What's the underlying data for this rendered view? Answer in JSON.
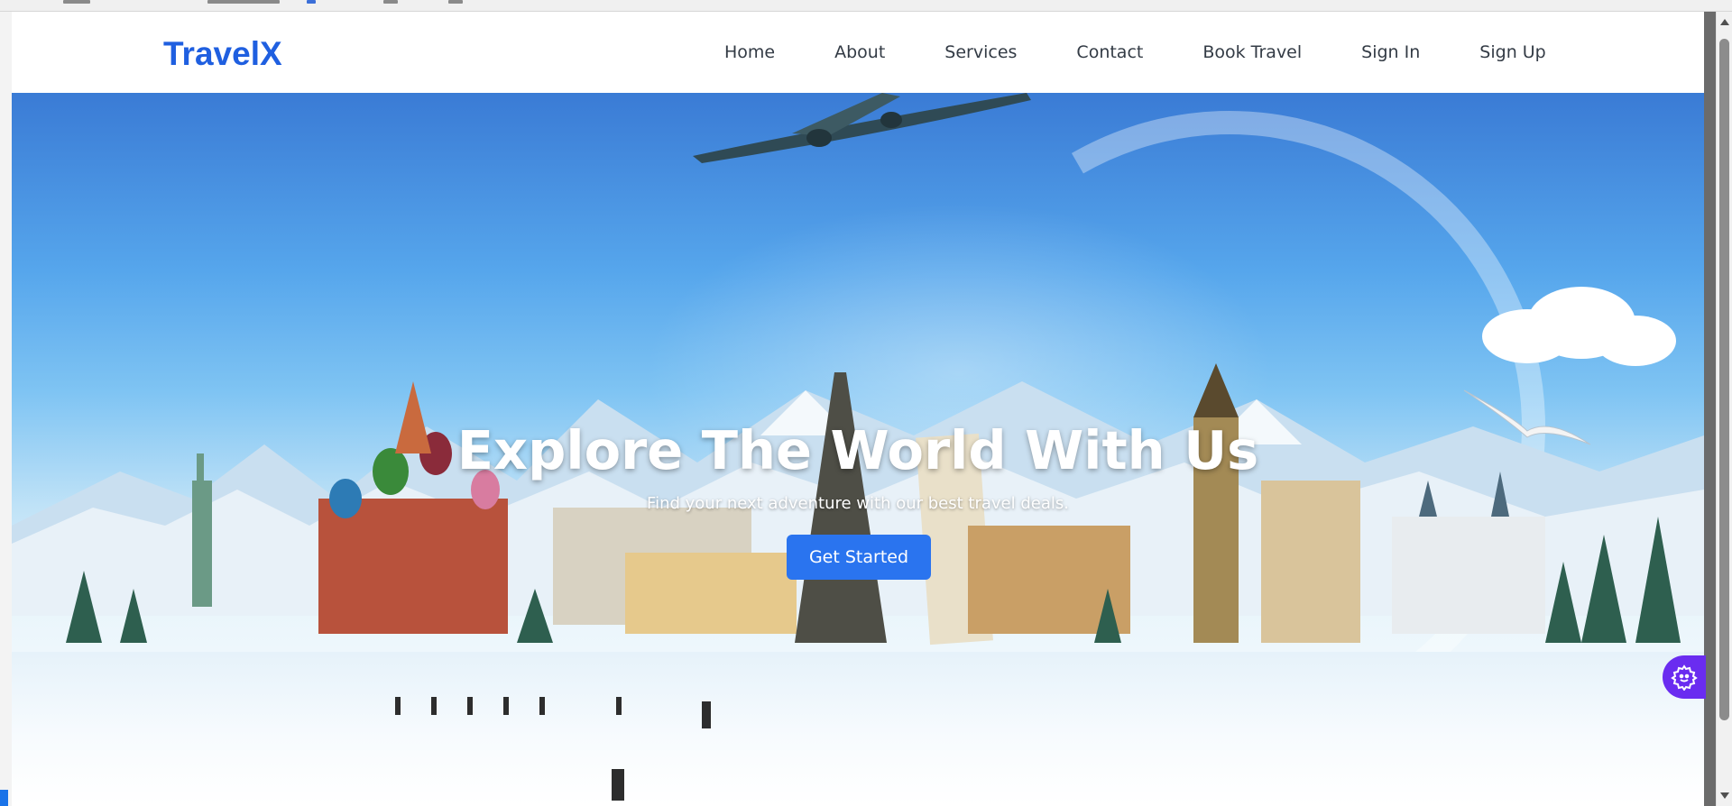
{
  "brand": {
    "name": "TravelX",
    "color": "#1f5fe0"
  },
  "nav": {
    "items": [
      {
        "label": "Home"
      },
      {
        "label": "About"
      },
      {
        "label": "Services"
      },
      {
        "label": "Contact"
      },
      {
        "label": "Book Travel"
      },
      {
        "label": "Sign In"
      },
      {
        "label": "Sign Up"
      }
    ]
  },
  "hero": {
    "title": "Explore The World With Us",
    "subtitle": "Find your next adventure with our best travel deals.",
    "cta_label": "Get Started",
    "cta_color": "#2a74ef",
    "background": "travel-landmarks-winter-scene"
  },
  "widgets": {
    "settings_icon": "gear-icon",
    "settings_color": "#6a2cf0"
  }
}
